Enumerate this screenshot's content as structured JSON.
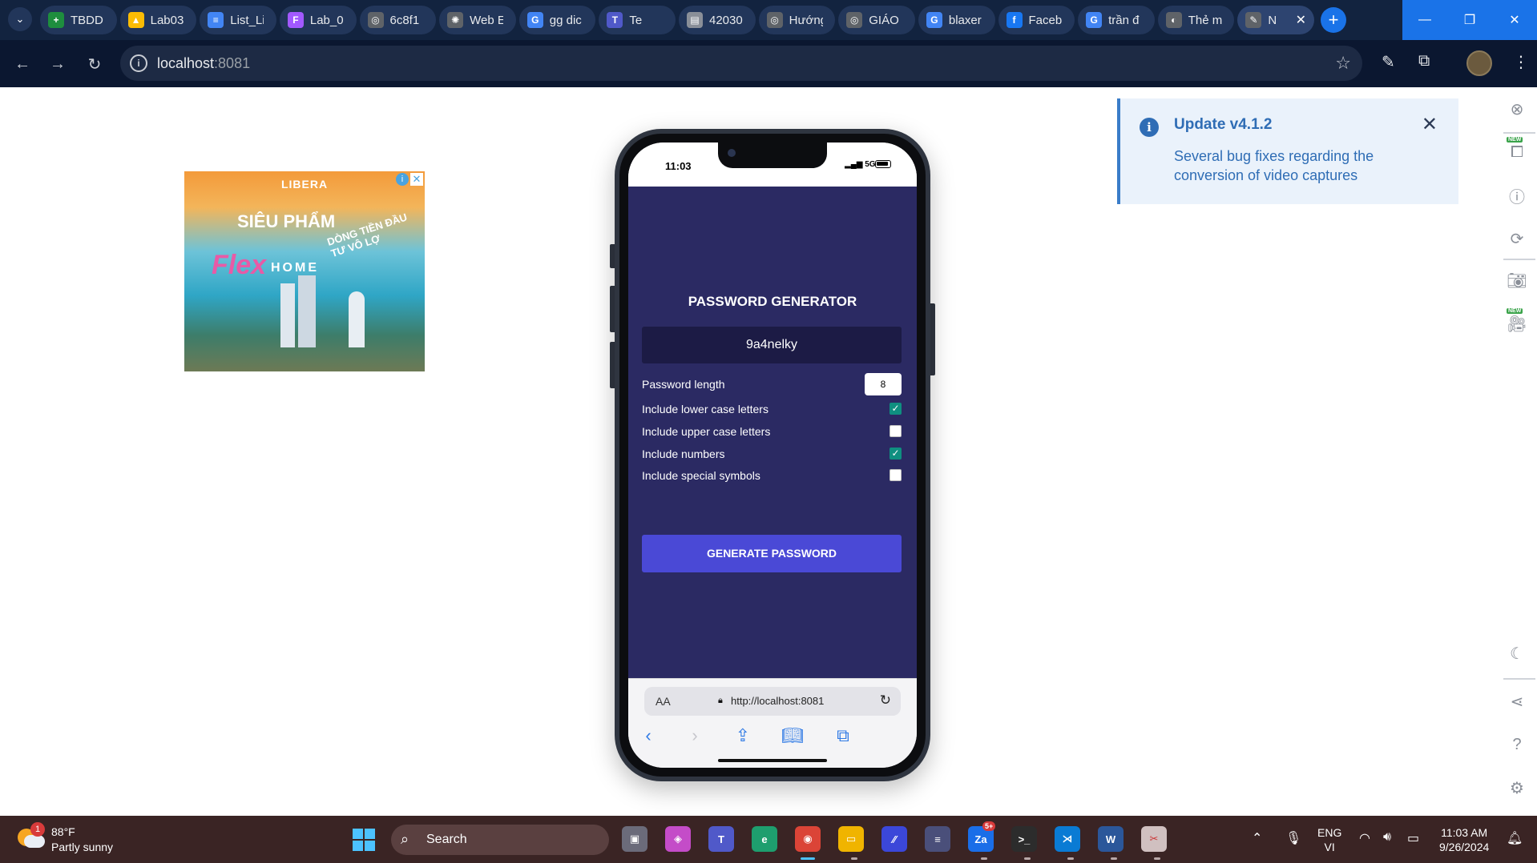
{
  "browser": {
    "tabs": [
      {
        "label": "TBDD",
        "color": "#1e8e3e",
        "glyph": "+"
      },
      {
        "label": "Lab03",
        "color": "#fbbc04",
        "glyph": "▲"
      },
      {
        "label": "List_Li",
        "color": "#4285f4",
        "glyph": "≡"
      },
      {
        "label": "Lab_0",
        "color": "#a259ff",
        "glyph": "F"
      },
      {
        "label": "6c8f1",
        "color": "#5f6368",
        "glyph": "◎"
      },
      {
        "label": "Web E",
        "color": "#5f6368",
        "glyph": "✺"
      },
      {
        "label": "gg dic",
        "color": "#4285f4",
        "glyph": "G"
      },
      {
        "label": "Te",
        "color": "#5059c9",
        "glyph": "T"
      },
      {
        "label": "42030",
        "color": "#8a8f98",
        "glyph": "▤"
      },
      {
        "label": "Hướng",
        "color": "#5f6368",
        "glyph": "◎"
      },
      {
        "label": "GIÁO",
        "color": "#5f6368",
        "glyph": "◎"
      },
      {
        "label": "blaxer",
        "color": "#4285f4",
        "glyph": "G"
      },
      {
        "label": "Faceb",
        "color": "#1877f2",
        "glyph": "f"
      },
      {
        "label": "trần đ",
        "color": "#4285f4",
        "glyph": "G"
      },
      {
        "label": "Thẻ m",
        "color": "#5f6368",
        "glyph": "◐"
      },
      {
        "label": "N",
        "color": "#5f6368",
        "glyph": "✎"
      }
    ],
    "url_host": "localhost",
    "url_port": ":8081"
  },
  "ad": {
    "brand": "LIBERA",
    "headline": "SIÊU PHẨM",
    "tagline": "DÒNG TIỀN ĐẦU TƯ VÔ LỢ",
    "script_word": "Flex",
    "product": "HOME"
  },
  "phone": {
    "time": "11:03",
    "network": "5G",
    "app": {
      "title": "PASSWORD GENERATOR",
      "password": "9a4nelky",
      "length_label": "Password length",
      "length_value": "8",
      "options": [
        {
          "label": "Include lower case letters",
          "checked": true
        },
        {
          "label": "Include upper case letters",
          "checked": false
        },
        {
          "label": "Include numbers",
          "checked": true
        },
        {
          "label": "Include special symbols",
          "checked": false
        }
      ],
      "generate_label": "GENERATE PASSWORD"
    },
    "safari": {
      "aa": "AA",
      "url": "http://localhost:8081"
    }
  },
  "toast": {
    "title": "Update v4.1.2",
    "message": "Several bug fixes regarding the conversion of video captures"
  },
  "sidebar": {
    "new_tag": "NEW"
  },
  "taskbar": {
    "weather_badge": "1",
    "temperature": "88°F",
    "condition": "Partly sunny",
    "search_label": "Search",
    "zalo_badge": "5+",
    "lang_top": "ENG",
    "lang_bottom": "VI",
    "time": "11:03 AM",
    "date": "9/26/2024"
  }
}
